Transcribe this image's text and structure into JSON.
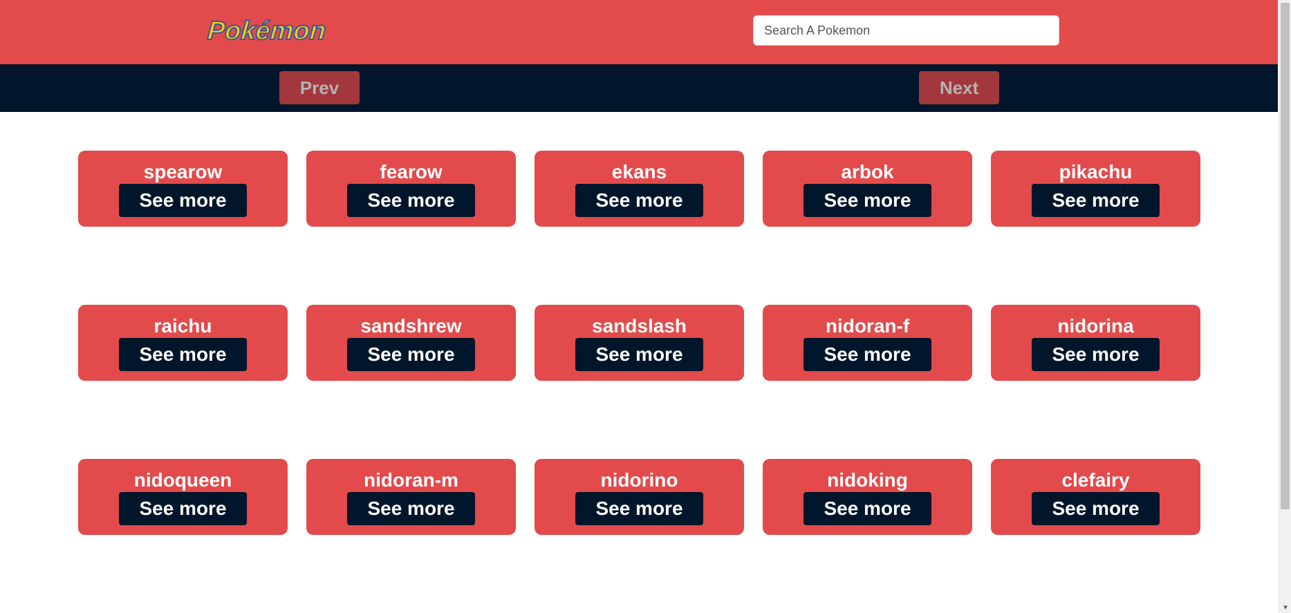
{
  "header": {
    "logo_text": "Pokémon",
    "search_placeholder": "Search A Pokemon"
  },
  "nav": {
    "prev_label": "Prev",
    "next_label": "Next"
  },
  "cards": [
    {
      "name": "spearow",
      "button": "See more"
    },
    {
      "name": "fearow",
      "button": "See more"
    },
    {
      "name": "ekans",
      "button": "See more"
    },
    {
      "name": "arbok",
      "button": "See more"
    },
    {
      "name": "pikachu",
      "button": "See more"
    },
    {
      "name": "raichu",
      "button": "See more"
    },
    {
      "name": "sandshrew",
      "button": "See more"
    },
    {
      "name": "sandslash",
      "button": "See more"
    },
    {
      "name": "nidoran-f",
      "button": "See more"
    },
    {
      "name": "nidorina",
      "button": "See more"
    },
    {
      "name": "nidoqueen",
      "button": "See more"
    },
    {
      "name": "nidoran-m",
      "button": "See more"
    },
    {
      "name": "nidorino",
      "button": "See more"
    },
    {
      "name": "nidoking",
      "button": "See more"
    },
    {
      "name": "clefairy",
      "button": "See more"
    }
  ],
  "colors": {
    "header_bg": "#e34a4b",
    "nav_bg": "#01162a",
    "card_bg": "#e34a4b",
    "card_button_bg": "#01162a",
    "nav_button_bg": "#a2383d"
  },
  "scrollbar": {
    "down_arrow_icon": "chevron-down-icon"
  }
}
